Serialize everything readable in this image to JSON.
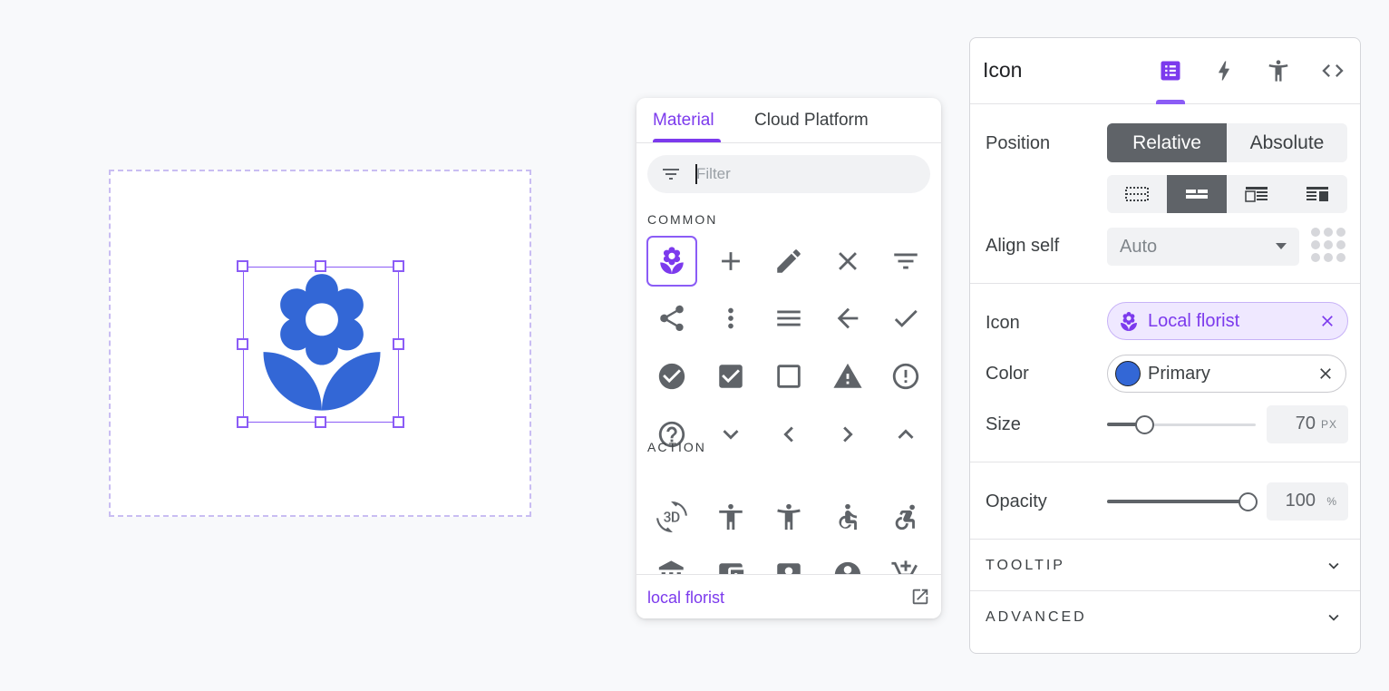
{
  "picker": {
    "tabs": [
      {
        "label": "Material"
      },
      {
        "label": "Cloud Platform"
      }
    ],
    "filter_placeholder": "Filter",
    "sections": [
      {
        "label": "COMMON"
      },
      {
        "label": "ACTION"
      }
    ],
    "common_icons": [
      "local-florist",
      "add",
      "edit",
      "close",
      "filter-list",
      "share",
      "more-vert",
      "menu",
      "arrow-back",
      "check",
      "check-circle",
      "check-box",
      "check-box-outline-blank",
      "warning",
      "error-outline",
      "help-outline",
      "expand-more",
      "chevron-left",
      "chevron-right",
      "expand-less"
    ],
    "action_icons": [
      "3d-rotation",
      "accessibility",
      "accessibility-new",
      "accessible",
      "accessible-forward",
      "account-balance",
      "account-balance-wallet",
      "account-box",
      "account-circle",
      "add-shopping-cart"
    ],
    "selected_name": "local florist"
  },
  "panel": {
    "title": "Icon",
    "tabs": [
      "properties-icon",
      "bolt-icon",
      "accessibility-icon",
      "code-icon"
    ],
    "position": {
      "label": "Position",
      "options": [
        "Relative",
        "Absolute"
      ],
      "selected": "Relative"
    },
    "align_self": {
      "label": "Align self",
      "value": "Auto"
    },
    "icon": {
      "label": "Icon",
      "value": "Local florist"
    },
    "color": {
      "label": "Color",
      "value": "Primary",
      "swatch": "#3367d6"
    },
    "size": {
      "label": "Size",
      "value": "70",
      "unit": "PX",
      "fraction": 0.25
    },
    "opacity": {
      "label": "Opacity",
      "value": "100",
      "unit": "%",
      "fraction": 1.0
    },
    "sections": [
      {
        "label": "TOOLTIP"
      },
      {
        "label": "ADVANCED"
      }
    ]
  },
  "colors": {
    "accent": "#7c3aed",
    "primary": "#3367d6",
    "icon_gray": "#5f6368"
  }
}
